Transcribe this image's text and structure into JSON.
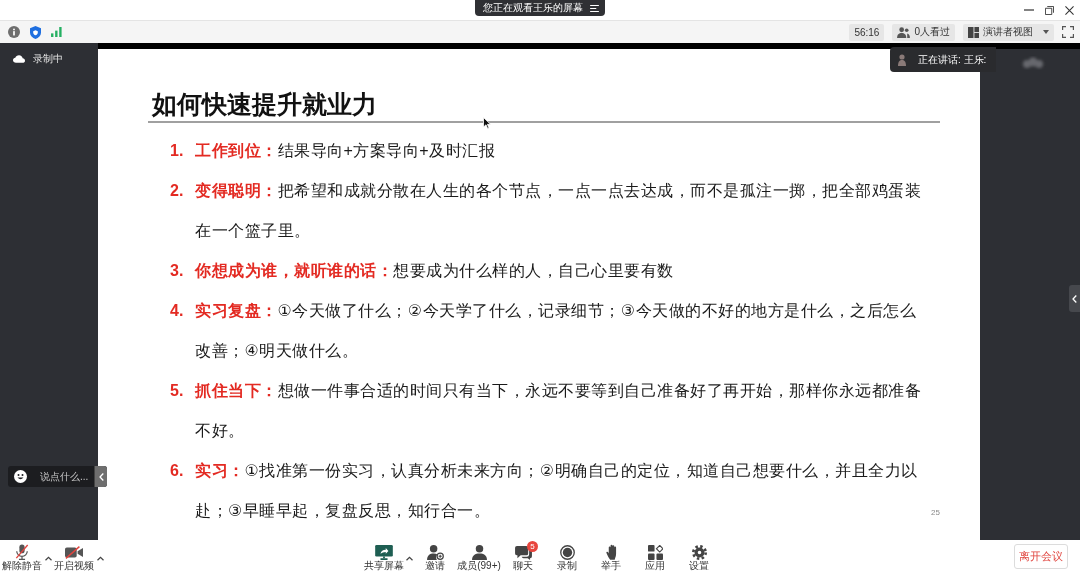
{
  "title_bar": {
    "banner": "您正在观看王乐的屏幕"
  },
  "toolbar": {
    "timer": "56:16",
    "viewers": "0人看过",
    "view_mode": "演讲者视图"
  },
  "left_panel": {
    "recording": "录制中"
  },
  "chat_input": {
    "placeholder": "说点什么..."
  },
  "speaker": {
    "label": "正在讲话: 王乐:"
  },
  "slide": {
    "title": "如何快速提升就业力",
    "items": [
      {
        "number": "1.",
        "text": "**工作到位：**结果导向+方案导向+及时汇报"
      },
      {
        "number": "2.",
        "text": "**变得聪明：**把希望和成就分散在人生的各个节点，一点一点去达成，而不是孤注一掷，把全部鸡蛋装在一个篮子里。"
      },
      {
        "number": "3.",
        "text": "**你想成为谁，就听谁的话：**想要成为什么样的人，自己心里要有数"
      },
      {
        "number": "4.",
        "text": "**实习复盘：**①今天做了什么；②今天学了什么，记录细节；③今天做的不好的地方是什么，之后怎么改善；④明天做什么。"
      },
      {
        "number": "5.",
        "text": "**抓住当下：**想做一件事合适的时间只有当下，永远不要等到自己准备好了再开始，那样你永远都准备不好。"
      },
      {
        "number": "6.",
        "text": "**实习：**①找准第一份实习，认真分析未来方向；②明确自己的定位，知道自己想要什么，并且全力以赴；③早睡早起，复盘反思，知行合一。"
      }
    ],
    "page": "25"
  },
  "left_controls": [
    {
      "kind": "mic",
      "label": "解除静音",
      "off": true,
      "menu": true
    },
    {
      "kind": "camera",
      "label": "开启视频",
      "off": true,
      "menu": true
    }
  ],
  "center_controls": [
    {
      "kind": "share",
      "label": "共享屏幕",
      "menu": true
    },
    {
      "kind": "invite",
      "label": "邀请",
      "menu": false
    },
    {
      "kind": "members",
      "label": "成员(99+)",
      "menu": false
    },
    {
      "kind": "chat",
      "label": "聊天",
      "menu": false,
      "badge": "5"
    },
    {
      "kind": "record",
      "label": "录制",
      "menu": false
    },
    {
      "kind": "hand",
      "label": "举手",
      "menu": false
    },
    {
      "kind": "apps",
      "label": "应用",
      "menu": false
    },
    {
      "kind": "settings",
      "label": "设置",
      "menu": false
    }
  ],
  "leave_button": "离开会议"
}
